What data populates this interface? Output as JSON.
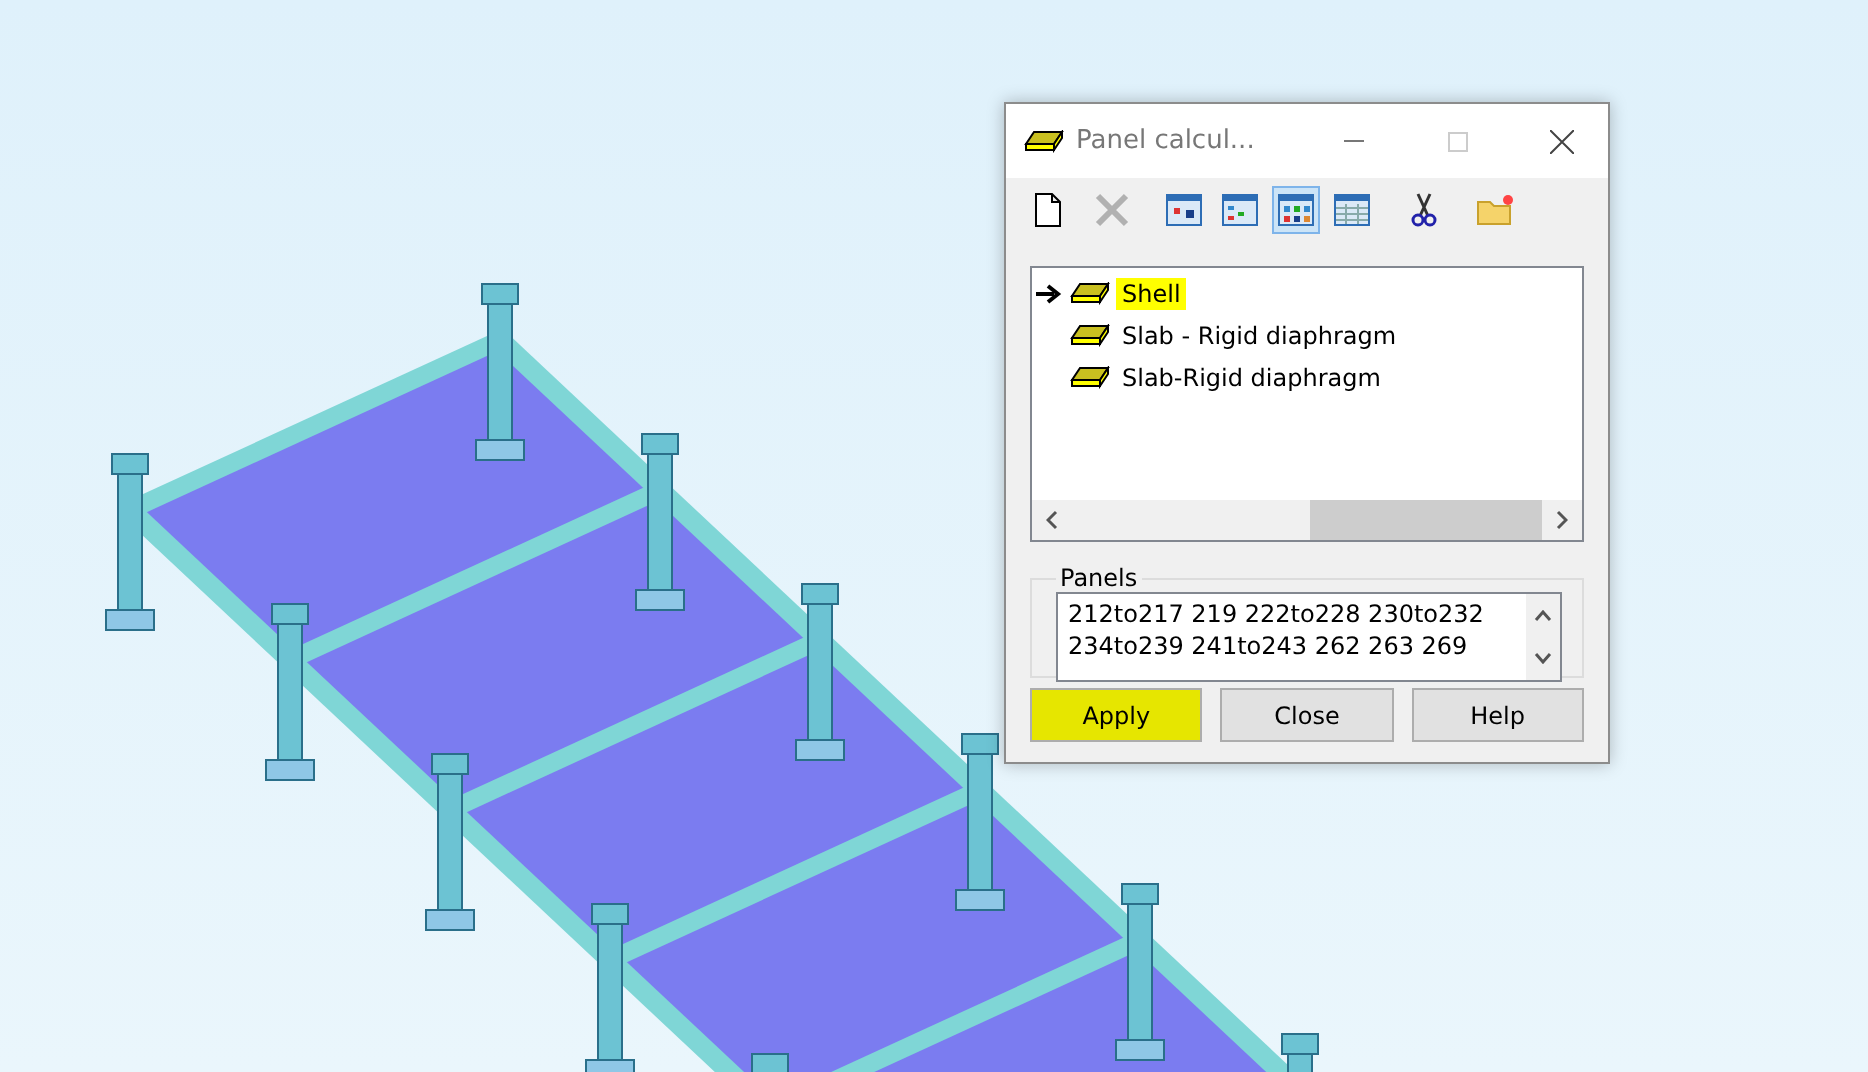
{
  "window": {
    "title": "Panel calcul..."
  },
  "toolbar": [
    {
      "kind": "new",
      "disabled": false,
      "selected": false
    },
    {
      "kind": "delete",
      "disabled": true,
      "selected": false
    },
    {
      "kind": "view1",
      "disabled": false,
      "selected": false
    },
    {
      "kind": "view2",
      "disabled": false,
      "selected": false
    },
    {
      "kind": "view3",
      "disabled": false,
      "selected": true
    },
    {
      "kind": "view4",
      "disabled": false,
      "selected": false
    },
    {
      "kind": "cut",
      "disabled": false,
      "selected": false
    },
    {
      "kind": "open",
      "disabled": false,
      "selected": false
    }
  ],
  "list": [
    {
      "label": "Shell",
      "selected": true
    },
    {
      "label": "Slab - Rigid diaphragm",
      "selected": false
    },
    {
      "label": "Slab-Rigid diaphragm",
      "selected": false
    }
  ],
  "panels": {
    "label": "Panels",
    "lines": [
      "212to217 219 222to228 230to232",
      "234to239 241to243 262 263 269"
    ]
  },
  "buttons": [
    {
      "label": "Apply",
      "highlighted": true
    },
    {
      "label": "Close",
      "highlighted": false
    },
    {
      "label": "Help",
      "highlighted": false
    }
  ]
}
